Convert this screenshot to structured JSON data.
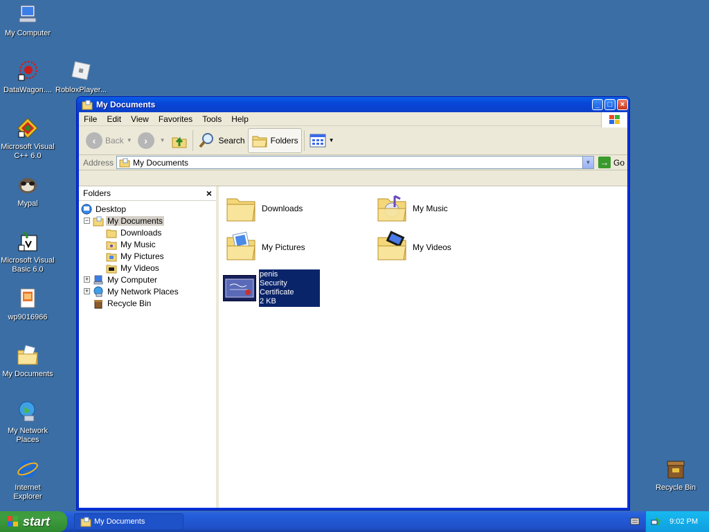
{
  "desktop": {
    "icons": [
      {
        "label": "My Computer",
        "icon": "computer-icon"
      },
      {
        "label": "DataWagon....",
        "icon": "datawagon-icon"
      },
      {
        "label": "RobloxPlayer...",
        "icon": "roblox-icon"
      },
      {
        "label": "Microsoft Visual C++ 6.0",
        "icon": "visual-cpp-icon"
      },
      {
        "label": "Mypal",
        "icon": "mypal-icon"
      },
      {
        "label": "Microsoft Visual Basic 6.0",
        "icon": "visual-basic-icon"
      },
      {
        "label": "wp9016966",
        "icon": "image-file-icon"
      },
      {
        "label": "My Documents",
        "icon": "my-documents-icon"
      },
      {
        "label": "My Network Places",
        "icon": "network-icon"
      },
      {
        "label": "Internet Explorer",
        "icon": "ie-icon"
      },
      {
        "label": "Recycle Bin",
        "icon": "recycle-bin-icon"
      }
    ]
  },
  "window": {
    "title": "My Documents",
    "menu": [
      "File",
      "Edit",
      "View",
      "Favorites",
      "Tools",
      "Help"
    ],
    "toolbar": {
      "back": "Back",
      "search": "Search",
      "folders": "Folders"
    },
    "address": {
      "label": "Address",
      "value": "My Documents",
      "go": "Go"
    },
    "folders_pane": {
      "title": "Folders",
      "close": "×",
      "tree": [
        {
          "label": "Desktop",
          "icon": "desktop-icon"
        },
        {
          "label": "My Documents",
          "icon": "my-documents-icon"
        },
        {
          "label": "Downloads",
          "icon": "folder-icon"
        },
        {
          "label": "My Music",
          "icon": "music-folder-icon"
        },
        {
          "label": "My Pictures",
          "icon": "pictures-folder-icon"
        },
        {
          "label": "My Videos",
          "icon": "videos-folder-icon"
        },
        {
          "label": "My Computer",
          "icon": "computer-icon"
        },
        {
          "label": "My Network Places",
          "icon": "network-icon"
        },
        {
          "label": "Recycle Bin",
          "icon": "recycle-bin-icon"
        }
      ]
    },
    "files": [
      {
        "label": "Downloads",
        "icon": "folder-icon"
      },
      {
        "label": "My Music",
        "icon": "music-folder-icon"
      },
      {
        "label": "My Pictures",
        "icon": "pictures-folder-icon"
      },
      {
        "label": "My Videos",
        "icon": "videos-folder-icon"
      }
    ],
    "selected_file": {
      "name": "penis",
      "type": "Security Certificate",
      "size": "2 KB",
      "icon": "certificate-icon"
    }
  },
  "taskbar": {
    "start": "start",
    "task": "My Documents",
    "clock": "9:02 PM"
  },
  "colors": {
    "desktop": "#3a6ea5",
    "selection": "#0a246a",
    "title": "#0846d8"
  }
}
